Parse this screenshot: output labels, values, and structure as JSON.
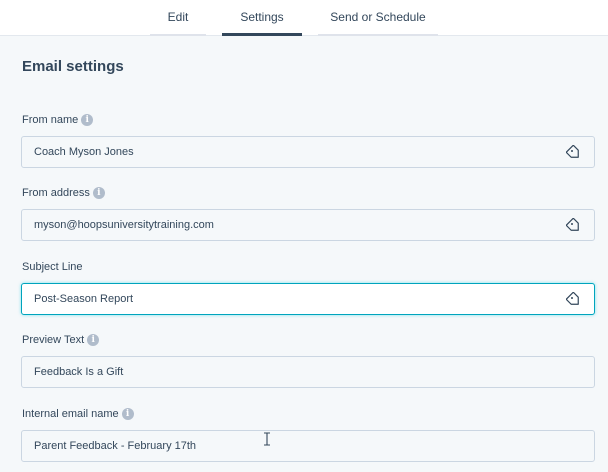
{
  "tabs": [
    {
      "label": "Edit"
    },
    {
      "label": "Settings"
    },
    {
      "label": "Send or Schedule"
    }
  ],
  "section_title": "Email settings",
  "fields": {
    "from_name": {
      "label": "From name",
      "value": "Coach Myson Jones"
    },
    "from_address": {
      "label": "From address",
      "value": "myson@hoopsuniversitytraining.com"
    },
    "subject_line": {
      "label": "Subject Line",
      "value": "Post-Season Report"
    },
    "preview_text": {
      "label": "Preview Text",
      "value": "Feedback Is a Gift"
    },
    "internal_name": {
      "label": "Internal email name",
      "value": "Parent Feedback - February 17th"
    }
  },
  "icons": {
    "info": "info-icon",
    "tag": "tag-icon",
    "cursor": "text-cursor-icon"
  },
  "colors": {
    "active_tab_underline": "#33475b",
    "focus_border": "#00a4bd",
    "text": "#33475b",
    "info_icon": "#b0bccb"
  }
}
